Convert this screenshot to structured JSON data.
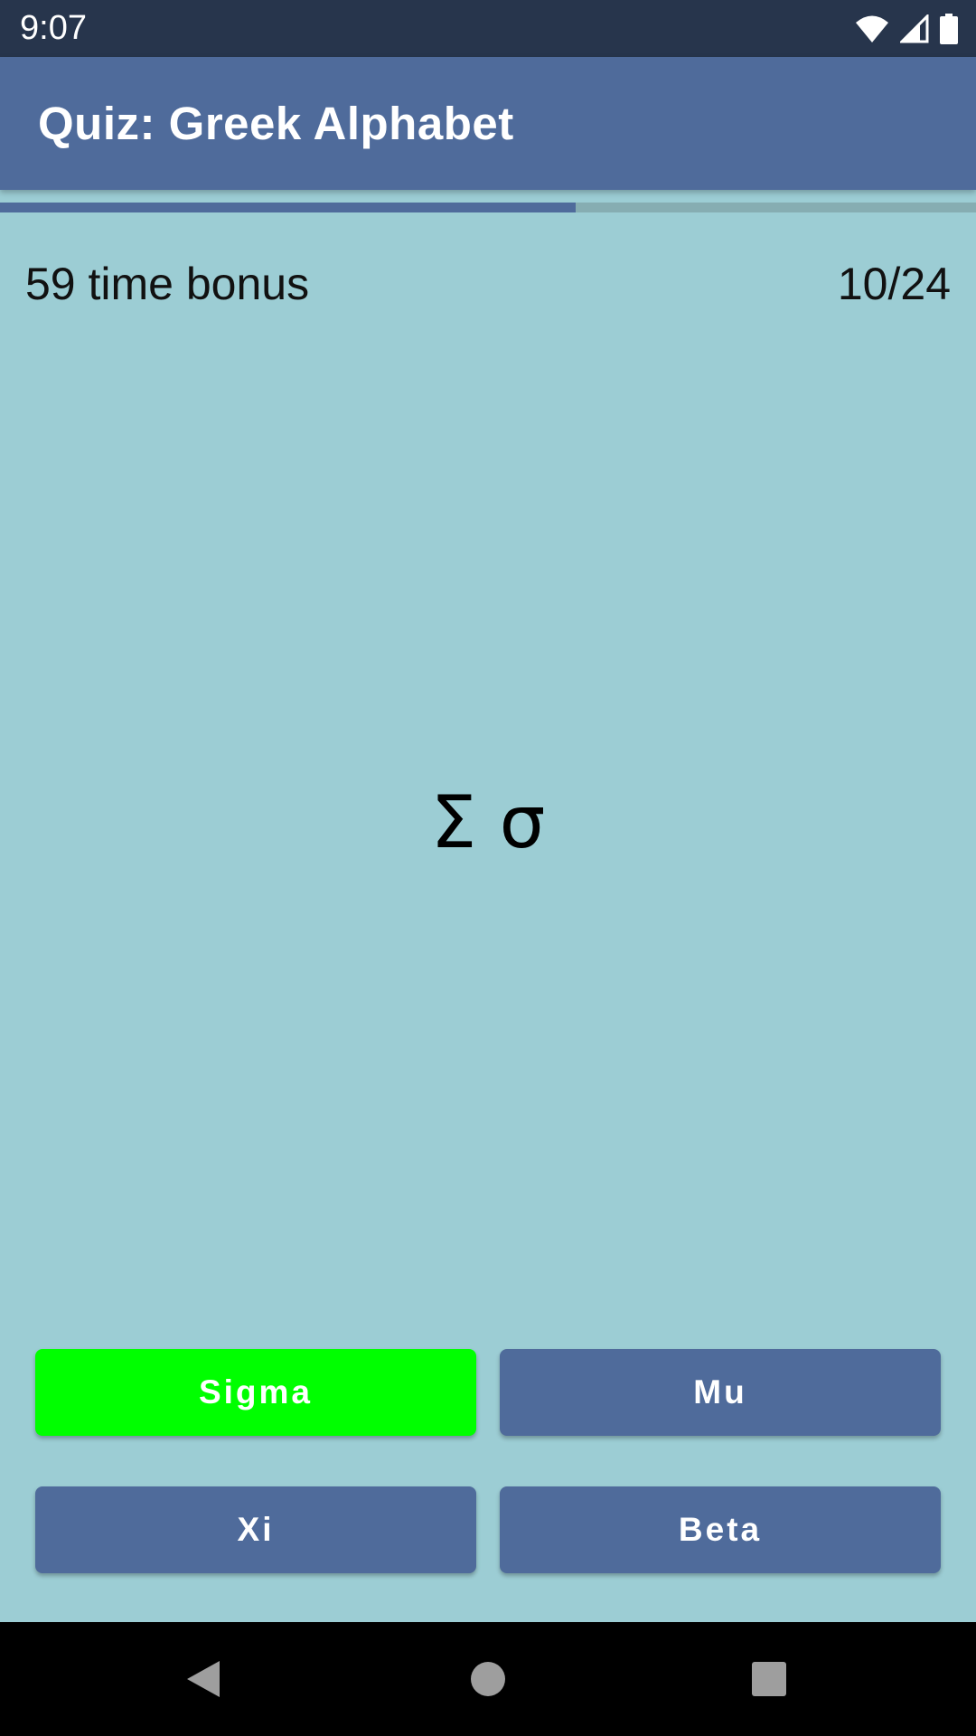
{
  "status_bar": {
    "time": "9:07",
    "icons": [
      "wifi-icon",
      "signal-icon",
      "battery-icon"
    ]
  },
  "app_bar": {
    "title": "Quiz: Greek Alphabet"
  },
  "progress": {
    "fraction": 0.59
  },
  "info": {
    "bonus": "59 time bonus",
    "counter": "10/24"
  },
  "question": {
    "letter": "Σ σ"
  },
  "answers": [
    {
      "label": "Sigma",
      "state": "correct"
    },
    {
      "label": "Mu",
      "state": "default"
    },
    {
      "label": "Xi",
      "state": "default"
    },
    {
      "label": "Beta",
      "state": "default"
    }
  ],
  "colors": {
    "background": "#9ccdd4",
    "status_bar": "#27354c",
    "primary": "#4f6b9b",
    "correct": "#00ff00",
    "progress_track": "#86adb2"
  },
  "nav_bar": {
    "buttons": [
      "back-icon",
      "home-icon",
      "recents-icon"
    ]
  }
}
